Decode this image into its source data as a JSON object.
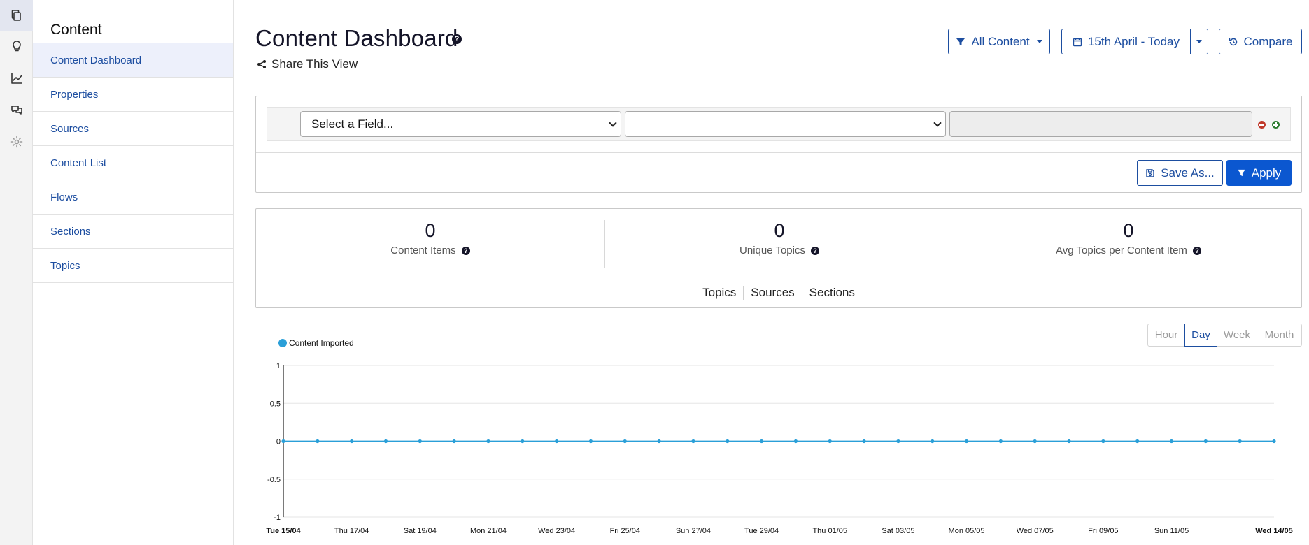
{
  "rail": {
    "items": [
      {
        "icon": "copy-icon",
        "active": true
      },
      {
        "icon": "lightbulb-icon",
        "active": false
      },
      {
        "icon": "line-chart-icon",
        "active": false
      },
      {
        "icon": "chat-icon",
        "active": false
      },
      {
        "icon": "gear-icon",
        "active": false
      }
    ]
  },
  "sidebar": {
    "title": "Content",
    "items": [
      {
        "label": "Content Dashboard",
        "active": true
      },
      {
        "label": "Properties"
      },
      {
        "label": "Sources"
      },
      {
        "label": "Content List"
      },
      {
        "label": "Flows"
      },
      {
        "label": "Sections"
      },
      {
        "label": "Topics"
      }
    ]
  },
  "header": {
    "title": "Content Dashboard",
    "help": "?",
    "share_label": "Share This View",
    "filter_button": "All Content",
    "date_range": "15th April - Today",
    "compare_button": "Compare"
  },
  "filter": {
    "field_placeholder": "Select a Field...",
    "operator_value": "",
    "value_text": "",
    "save_as_label": "Save As...",
    "apply_label": "Apply"
  },
  "stats": {
    "items": [
      {
        "value": "0",
        "label": "Content Items"
      },
      {
        "value": "0",
        "label": "Unique Topics"
      },
      {
        "value": "0",
        "label": "Avg Topics per Content Item"
      }
    ],
    "tabs": [
      "Topics",
      "Sources",
      "Sections"
    ]
  },
  "granularity": {
    "options": [
      "Hour",
      "Day",
      "Week",
      "Month"
    ],
    "selected": "Day"
  },
  "colors": {
    "accent": "#1d4ea0",
    "primary": "#0b57d0",
    "series": "#2a9fd8"
  },
  "chart_data": {
    "type": "line",
    "legend": [
      "Content Imported"
    ],
    "legend_position": "top-left",
    "ylim": [
      -1,
      1
    ],
    "yticks": [
      "1",
      "0.5",
      "0",
      "-0.5",
      "-1"
    ],
    "x_tick_labels": [
      "Tue 15/04",
      "Thu 17/04",
      "Sat 19/04",
      "Mon 21/04",
      "Wed 23/04",
      "Fri 25/04",
      "Sun 27/04",
      "Tue 29/04",
      "Thu 01/05",
      "Sat 03/05",
      "Mon 05/05",
      "Wed 07/05",
      "Fri 09/05",
      "Sun 11/05",
      "Wed 14/05"
    ],
    "series": [
      {
        "name": "Content Imported",
        "x": [
          "15/04",
          "16/04",
          "17/04",
          "18/04",
          "19/04",
          "20/04",
          "21/04",
          "22/04",
          "23/04",
          "24/04",
          "25/04",
          "26/04",
          "27/04",
          "28/04",
          "29/04",
          "30/04",
          "01/05",
          "02/05",
          "03/05",
          "04/05",
          "05/05",
          "06/05",
          "07/05",
          "08/05",
          "09/05",
          "10/05",
          "11/05",
          "12/05",
          "13/05",
          "14/05"
        ],
        "values": [
          0,
          0,
          0,
          0,
          0,
          0,
          0,
          0,
          0,
          0,
          0,
          0,
          0,
          0,
          0,
          0,
          0,
          0,
          0,
          0,
          0,
          0,
          0,
          0,
          0,
          0,
          0,
          0,
          0,
          0
        ]
      }
    ],
    "grid": true
  }
}
